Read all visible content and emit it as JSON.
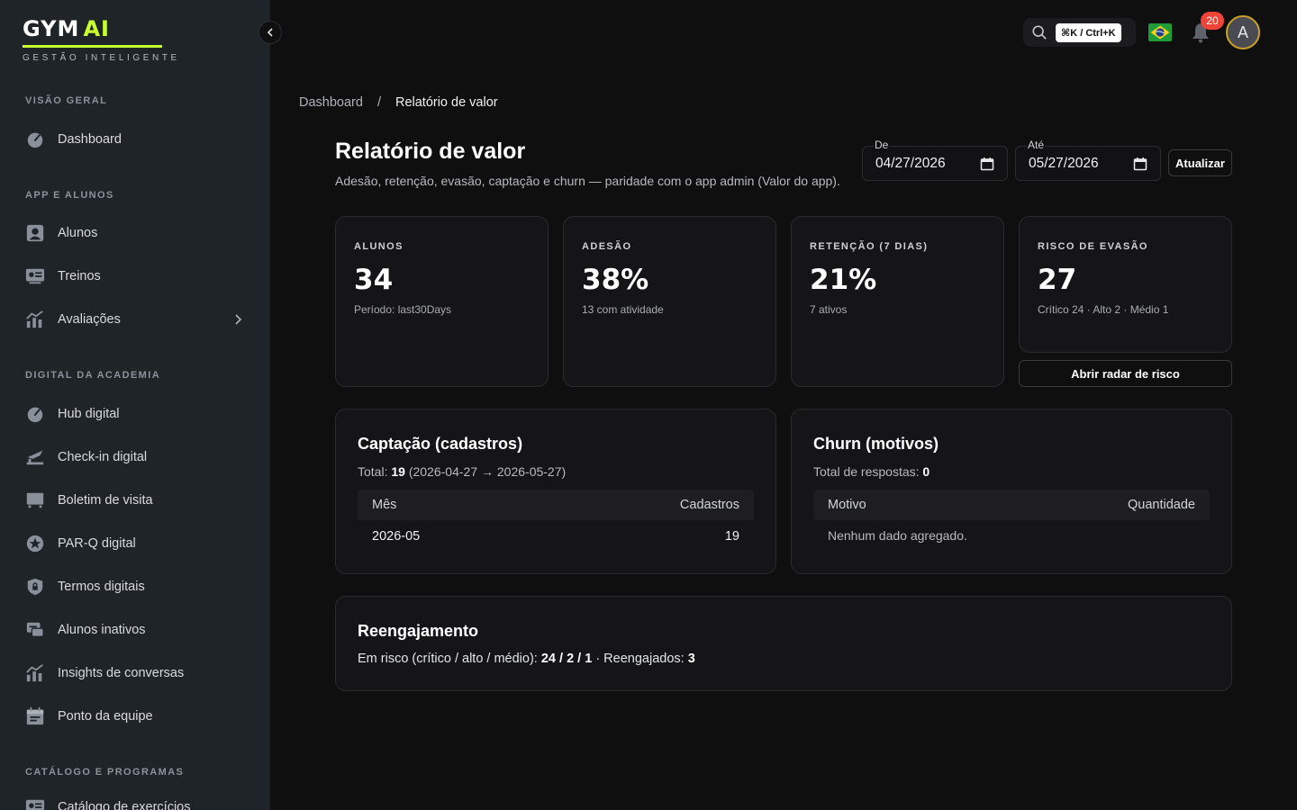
{
  "brand": {
    "name": "GYM",
    "name_accent": "AI",
    "tagline": "GESTÃO INTELIGENTE",
    "accent_color": "#c8ff2e"
  },
  "sidebar": {
    "sections": [
      {
        "title": "VISÃO GERAL",
        "items": [
          {
            "label": "Dashboard",
            "icon": "gauge-icon"
          }
        ]
      },
      {
        "title": "APP E ALUNOS",
        "items": [
          {
            "label": "Alunos",
            "icon": "person-icon"
          },
          {
            "label": "Treinos",
            "icon": "id-card-icon"
          },
          {
            "label": "Avaliações",
            "icon": "chart-icon",
            "has_submenu": true
          }
        ]
      },
      {
        "title": "DIGITAL DA ACADEMIA",
        "items": [
          {
            "label": "Hub digital",
            "icon": "gauge-icon"
          },
          {
            "label": "Check-in digital",
            "icon": "checkin-icon"
          },
          {
            "label": "Boletim de visita",
            "icon": "screen-icon"
          },
          {
            "label": "PAR-Q digital",
            "icon": "star-icon"
          },
          {
            "label": "Termos digitais",
            "icon": "lock-shield-icon"
          },
          {
            "label": "Alunos inativos",
            "icon": "chat-icon"
          },
          {
            "label": "Insights de conversas",
            "icon": "chart-icon"
          },
          {
            "label": "Ponto da equipe",
            "icon": "calendar-icon"
          }
        ]
      },
      {
        "title": "CATÁLOGO E PROGRAMAS",
        "items": [
          {
            "label": "Catálogo de exercícios",
            "icon": "id-card-icon"
          }
        ]
      }
    ]
  },
  "topbar": {
    "search_shortcut": "⌘K / Ctrl+K",
    "notification_count": "20",
    "avatar_initial": "A",
    "flag": "brazil-flag"
  },
  "breadcrumb": {
    "root": "Dashboard",
    "separator": "/",
    "current": "Relatório de valor"
  },
  "header": {
    "title": "Relatório de valor",
    "subtitle": "Adesão, retenção, evasão, captação e churn — paridade com o app admin (Valor do app).",
    "from_label": "De",
    "from_value": "04/27/2026",
    "to_label": "Até",
    "to_value": "05/27/2026",
    "update_button": "Atualizar"
  },
  "kpis": [
    {
      "label": "ALUNOS",
      "value": "34",
      "sub": "Período: last30Days"
    },
    {
      "label": "ADESÃO",
      "value": "38%",
      "sub": "13 com atividade"
    },
    {
      "label": "RETENÇÃO (7 DIAS)",
      "value": "21%",
      "sub": "7 ativos"
    },
    {
      "label": "RISCO DE EVASÃO",
      "value": "27",
      "sub": "Crítico 24 · Alto 2 · Médio 1"
    }
  ],
  "risk_button": "Abrir radar de risco",
  "captacao": {
    "title": "Captação (cadastros)",
    "total_prefix": "Total: ",
    "total_value": "19",
    "total_range": " (2026-04-27 → 2026-05-27)",
    "columns": [
      "Mês",
      "Cadastros"
    ],
    "rows": [
      {
        "month": "2026-05",
        "count": "19"
      }
    ]
  },
  "churn": {
    "title": "Churn (motivos)",
    "total_prefix": "Total de respostas: ",
    "total_value": "0",
    "columns": [
      "Motivo",
      "Quantidade"
    ],
    "empty": "Nenhum dado agregado."
  },
  "reengajamento": {
    "title": "Reengajamento",
    "prefix": "Em risco (crítico / alto / médio): ",
    "risk_values": "24 / 2 / 1",
    "middle": " · Reengajados: ",
    "reengaged": "3"
  }
}
